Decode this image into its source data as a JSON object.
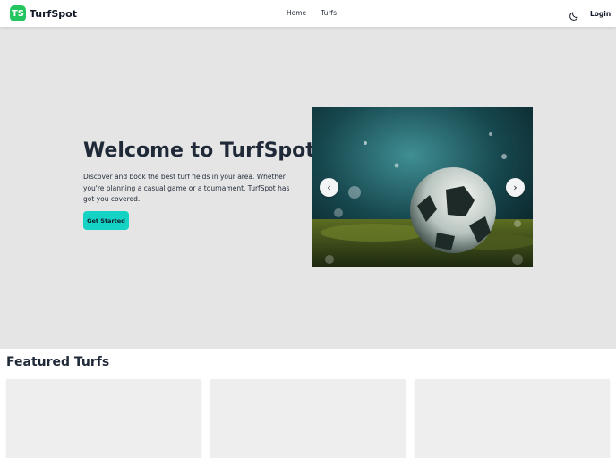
{
  "brand": {
    "logo_text": "TS",
    "name": "TurfSpot",
    "logo_color": "#22c55e"
  },
  "nav": {
    "links": [
      "Home",
      "Turfs"
    ],
    "theme_toggle_icon": "moon-icon",
    "login_label": "Login"
  },
  "hero": {
    "title": "Welcome to TurfSpot",
    "description": "Discover and book the best turf fields in your area. Whether you're planning a casual game or a tournament, TurfSpot has got you covered.",
    "cta_label": "Get Started",
    "cta_color": "#14d3c4",
    "background": "#e5e5e5"
  },
  "carousel": {
    "prev_label": "‹",
    "next_label": "›",
    "image": "soccer-ball-on-turf"
  },
  "featured": {
    "title": "Featured Turfs",
    "card_count": 3
  }
}
